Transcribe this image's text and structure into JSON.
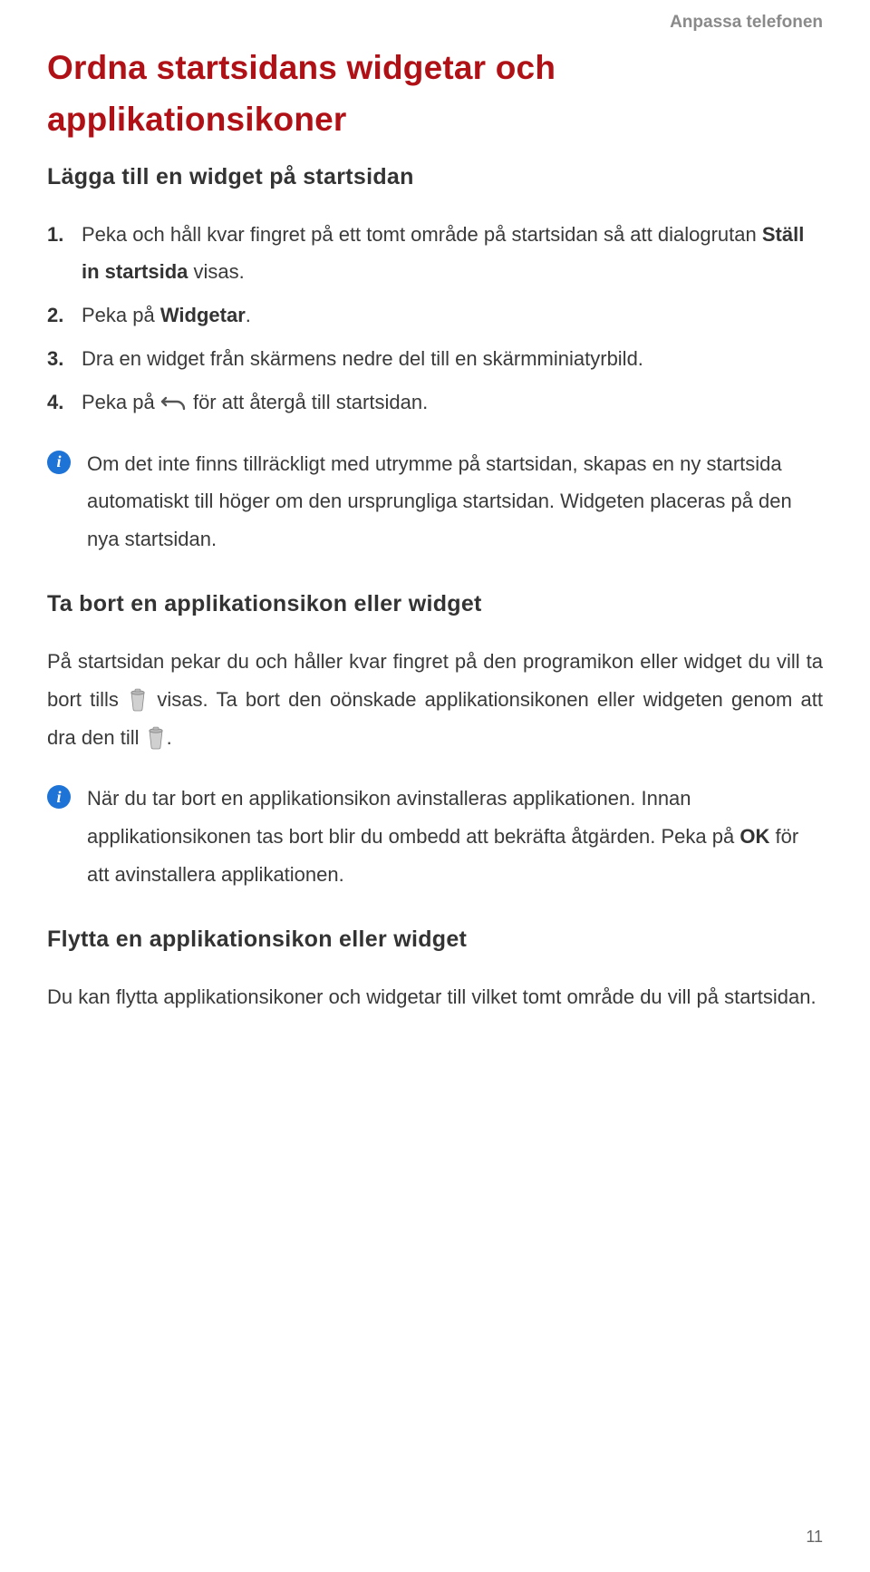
{
  "header": {
    "section": "Anpassa telefonen"
  },
  "title": "Ordna startsidans widgetar och applikationsikoner",
  "section1": {
    "heading": "Lägga till en widget på startsidan",
    "steps": {
      "s1a": "Peka och håll kvar fingret på ett tomt område på startsidan så att dialogrutan ",
      "s1b": "Ställ in startsida",
      "s1c": " visas.",
      "s2a": "Peka på ",
      "s2b": "Widgetar",
      "s2c": ".",
      "s3": "Dra en widget från skärmens nedre del till en skärmminiatyrbild.",
      "s4a": "Peka på ",
      "s4b": " för att återgå till startsidan."
    },
    "info": "Om det inte finns tillräckligt med utrymme på startsidan, skapas en ny startsida automatiskt till höger om den ursprungliga startsidan. Widgeten placeras på den nya startsidan."
  },
  "section2": {
    "heading": "Ta bort en applikationsikon eller widget",
    "para_a": "På startsidan pekar du och håller kvar fingret på den programikon eller widget du vill ta bort tills ",
    "para_b": " visas. Ta bort den oönskade applikationsikonen eller widgeten genom att dra den till ",
    "para_c": ".",
    "info_a": "När du tar bort en applikationsikon avinstalleras applikationen. Innan applikationsikonen tas bort blir du ombedd att bekräfta åtgärden. Peka på ",
    "info_b": "OK",
    "info_c": " för att avinstallera applikationen."
  },
  "section3": {
    "heading": "Flytta en applikationsikon eller widget",
    "para": "Du kan flytta applikationsikoner och widgetar till vilket tomt område du vill på startsidan."
  },
  "pageNumber": "11",
  "info_badge_glyph": "i"
}
